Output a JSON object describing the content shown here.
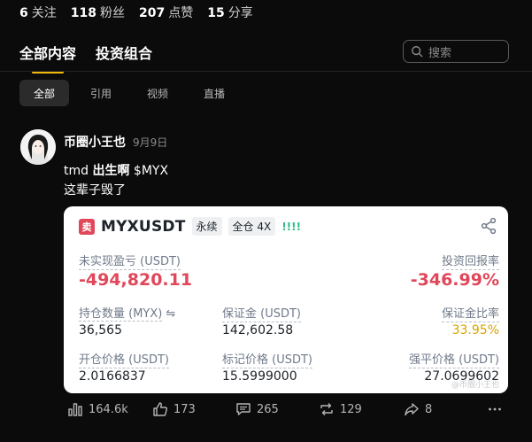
{
  "stats": [
    {
      "count": "6",
      "label": "关注"
    },
    {
      "count": "118",
      "label": "粉丝"
    },
    {
      "count": "207",
      "label": "点赞"
    },
    {
      "count": "15",
      "label": "分享"
    }
  ],
  "tabs": [
    "全部内容",
    "投资组合"
  ],
  "search": {
    "placeholder": "搜索"
  },
  "subtabs": [
    "全部",
    "引用",
    "视频",
    "直播"
  ],
  "post": {
    "author": "币圈小王也",
    "date": "9月9日",
    "line1_prefix": "tmd ",
    "line1_accent": "出生啊",
    "line1_suffix": " $MYX",
    "line2": "这辈子毁了"
  },
  "card": {
    "badge": "卖",
    "symbol": "MYXUSDT",
    "tag_perpetual": "永续",
    "tag_margin": "全仓 4X",
    "bars": "!!!!",
    "unrealized_label": "未实现盈亏 (USDT)",
    "unrealized_value": "-494,820.11",
    "roi_label": "投资回报率",
    "roi_value": "-346.99%",
    "position_label": "持仓数量 (MYX)",
    "position_value": "36,565",
    "margin_label": "保证金 (USDT)",
    "margin_value": "142,602.58",
    "margin_ratio_label": "保证金比率",
    "margin_ratio_value": "33.95%",
    "entry_label": "开仓价格 (USDT)",
    "entry_value": "2.0166837",
    "mark_label": "标记价格 (USDT)",
    "mark_value": "15.5999000",
    "liq_label": "强平价格 (USDT)",
    "liq_value": "27.0699602",
    "watermark": "@币圈小王也"
  },
  "actions": {
    "views": "164.6k",
    "likes": "173",
    "comments": "265",
    "reposts": "129",
    "shares": "8"
  },
  "colors": {
    "accent": "#f0b90b",
    "loss": "#e0475a",
    "gold": "#d9a400",
    "green": "#2ebd85"
  }
}
